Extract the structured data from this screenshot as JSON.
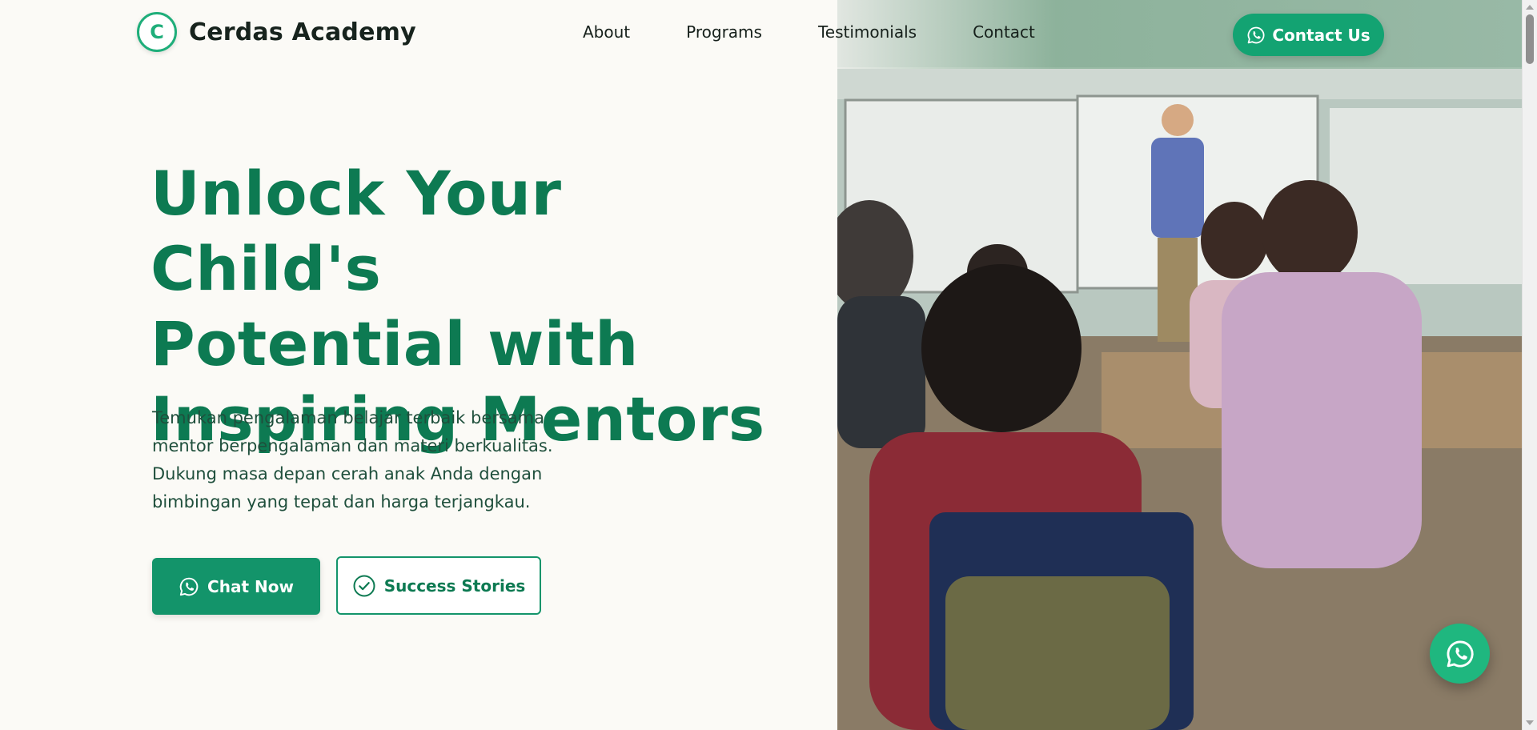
{
  "brand": {
    "logo_letter": "C",
    "name": "Cerdas Academy"
  },
  "nav": {
    "items": [
      {
        "label": "About"
      },
      {
        "label": "Programs"
      },
      {
        "label": "Testimonials"
      },
      {
        "label": "Contact"
      }
    ]
  },
  "header": {
    "contact_button": "Contact Us"
  },
  "hero": {
    "title_lines": [
      "Unlock Your Child's",
      "Potential with",
      "Inspiring Mentors"
    ],
    "description": "Temukan pengalaman belajar terbaik bersama mentor berpengalaman dan materi berkualitas. Dukung masa depan cerah anak Anda dengan bimbingan yang tepat dan harga terjangkau.",
    "primary_button": "Chat Now",
    "secondary_button": "Success Stories",
    "image_subject": "classroom-photo"
  },
  "icons": {
    "contact_button": "whatsapp-icon",
    "primary_button": "whatsapp-icon",
    "secondary_button": "check-circle-icon",
    "floating_button": "whatsapp-icon"
  },
  "colors": {
    "brand_green": "#13a372",
    "heading_green": "#0d7a52",
    "background": "#fbfaf6"
  }
}
